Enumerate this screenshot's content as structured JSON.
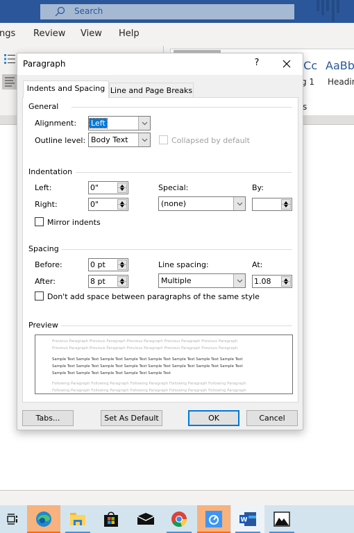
{
  "window": {
    "search_placeholder": "Search",
    "ribbon_tabs": [
      "ngs",
      "Review",
      "View",
      "Help"
    ],
    "styles_gallery": [
      {
        "preview": "bCc",
        "name": "g 1"
      },
      {
        "preview": "AaBbC",
        "name": "Headin"
      }
    ],
    "partial_text": "s"
  },
  "dialog": {
    "title": "Paragraph",
    "help_label": "?",
    "tabs": [
      {
        "label": "Indents and Spacing",
        "selected": true
      },
      {
        "label": "Line and Page Breaks",
        "selected": false
      }
    ],
    "general": {
      "heading": "General",
      "alignment_label": "Alignment:",
      "alignment_value": "Left",
      "outline_label": "Outline level:",
      "outline_value": "Body Text",
      "collapsed_label": "Collapsed by default",
      "collapsed_checked": false
    },
    "indentation": {
      "heading": "Indentation",
      "left_label": "Left:",
      "left_value": "0\"",
      "right_label": "Right:",
      "right_value": "0\"",
      "special_label": "Special:",
      "special_value": "(none)",
      "by_label": "By:",
      "by_value": "",
      "mirror_label": "Mirror indents",
      "mirror_checked": false
    },
    "spacing": {
      "heading": "Spacing",
      "before_label": "Before:",
      "before_value": "0 pt",
      "after_label": "After:",
      "after_value": "8 pt",
      "line_spacing_label": "Line spacing:",
      "line_spacing_value": "Multiple",
      "at_label": "At:",
      "at_value": "1.08",
      "dont_add_label": "Don't add space between paragraphs of the same style",
      "dont_add_checked": false
    },
    "preview": {
      "heading": "Preview",
      "prev_lines": [
        "Previous Paragraph Previous Paragraph Previous Paragraph Previous Paragraph Previous Paragraph",
        "Previous Paragraph Previous Paragraph Previous Paragraph Previous Paragraph Previous Paragraph"
      ],
      "sample_lines": [
        "Sample Text Sample Text Sample Text Sample Text Sample Text Sample Text Sample Text Sample Text",
        "Sample Text Sample Text Sample Text Sample Text Sample Text Sample Text Sample Text Sample Text",
        "Sample Text Sample Text Sample Text Sample Text Sample Text"
      ],
      "following_lines": [
        "Following Paragraph Following Paragraph Following Paragraph Following Paragraph Following Paragraph",
        "Following Paragraph Following Paragraph Following Paragraph Following Paragraph Following Paragraph"
      ]
    },
    "buttons": {
      "tabs": "Tabs...",
      "set_default": "Set As Default",
      "ok": "OK",
      "cancel": "Cancel"
    }
  },
  "taskbar": {
    "items": [
      "task-view",
      "edge",
      "file-explorer",
      "microsoft-store",
      "mail",
      "chrome",
      "app",
      "word",
      "photos"
    ]
  }
}
